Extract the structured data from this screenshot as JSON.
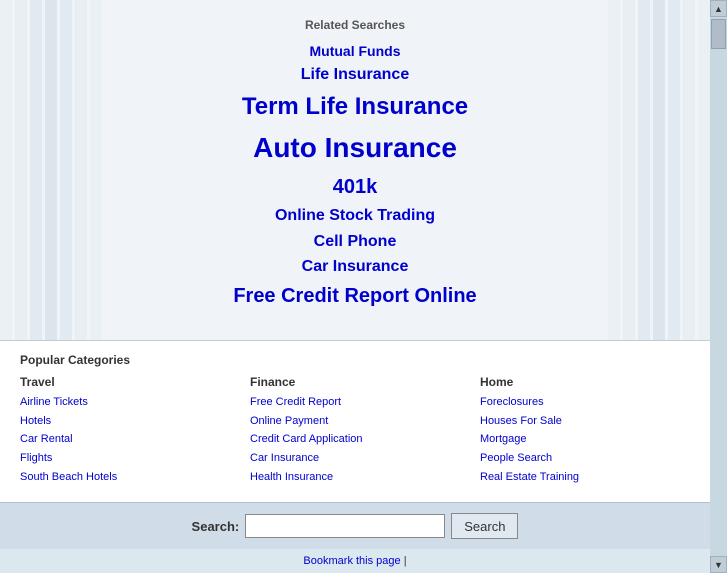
{
  "page": {
    "related_searches_title": "Related Searches",
    "search_links": [
      {
        "label": "Mutual Funds",
        "size": "size-sm"
      },
      {
        "label": "Life Insurance",
        "size": "size-md"
      },
      {
        "label": "Term Life Insurance",
        "size": "size-xl"
      },
      {
        "label": "Auto Insurance",
        "size": "size-xxl"
      },
      {
        "label": "401k",
        "size": "size-lg"
      },
      {
        "label": "Online Stock Trading",
        "size": "size-md"
      },
      {
        "label": "Cell Phone",
        "size": "size-md"
      },
      {
        "label": "Car Insurance",
        "size": "size-md"
      },
      {
        "label": "Free Credit Report Online",
        "size": "size-lg"
      }
    ],
    "popular_categories_title": "Popular Categories",
    "categories": [
      {
        "heading": "Travel",
        "links": [
          "Airline Tickets",
          "Hotels",
          "Car Rental",
          "Flights",
          "South Beach Hotels"
        ]
      },
      {
        "heading": "Finance",
        "links": [
          "Free Credit Report",
          "Online Payment",
          "Credit Card Application",
          "Car Insurance",
          "Health Insurance"
        ]
      },
      {
        "heading": "Home",
        "links": [
          "Foreclosures",
          "Houses For Sale",
          "Mortgage",
          "People Search",
          "Real Estate Training"
        ]
      }
    ],
    "search_label": "Search:",
    "search_button_label": "Search",
    "search_placeholder": "",
    "bookmark_text": "Bookmark this page",
    "bookmark_separator": " | "
  }
}
